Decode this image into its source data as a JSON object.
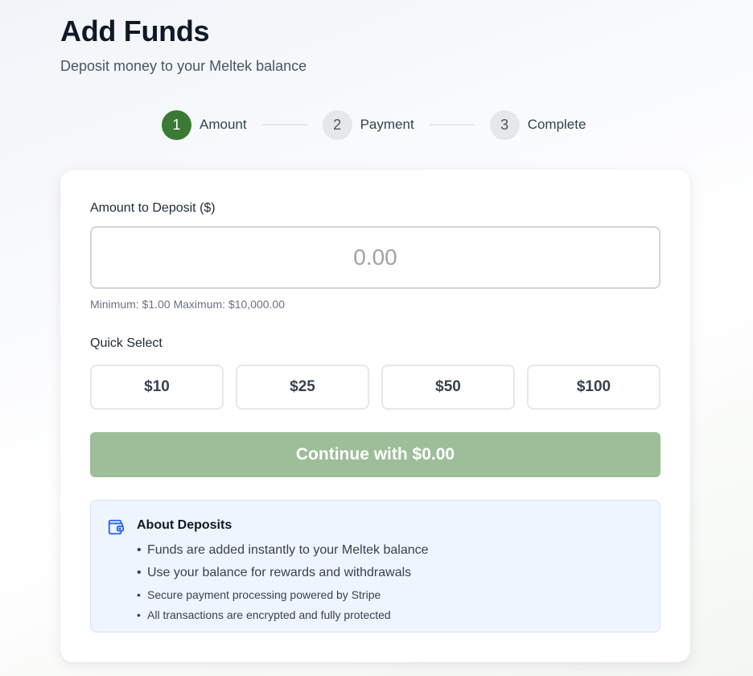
{
  "header": {
    "title": "Add Funds",
    "subtitle": "Deposit money to your Meltek balance"
  },
  "stepper": {
    "steps": [
      {
        "number": "1",
        "label": "Amount",
        "state": "active"
      },
      {
        "number": "2",
        "label": "Payment",
        "state": "inactive"
      },
      {
        "number": "3",
        "label": "Complete",
        "state": "inactive"
      }
    ]
  },
  "form": {
    "amount_label": "Amount to Deposit ($)",
    "amount_value": "",
    "amount_placeholder": "0.00",
    "hint": "Minimum: $1.00 Maximum: $10,000.00",
    "quick_select_label": "Quick Select",
    "quick_amounts": [
      "$10",
      "$25",
      "$50",
      "$100"
    ],
    "continue_label": "Continue with $0.00"
  },
  "info": {
    "icon": "wallet-icon",
    "title": "About Deposits",
    "items": [
      "Funds are added instantly to your Meltek balance",
      "Use your balance for rewards and withdrawals",
      "Secure payment processing powered by Stripe",
      "All transactions are encrypted and fully protected"
    ]
  },
  "colors": {
    "accent": "#3a7a35",
    "continue_disabled": "#9cbe98",
    "info_background": "#eff5fe",
    "info_icon": "#2563eb"
  }
}
